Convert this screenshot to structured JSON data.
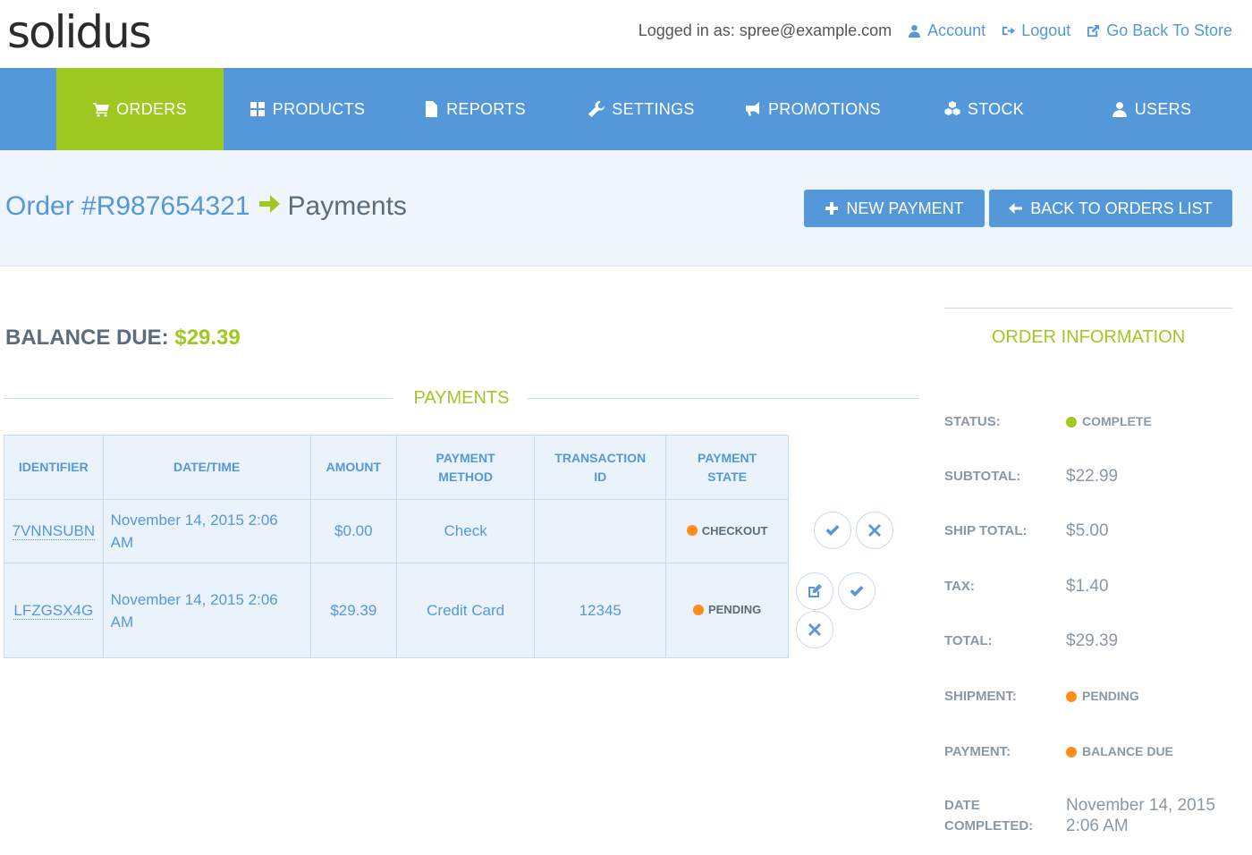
{
  "brand": {
    "logo": "solidus"
  },
  "topbar": {
    "logged_in": "Logged in as: spree@example.com",
    "account": "Account",
    "logout": "Logout",
    "store": "Go Back To Store"
  },
  "nav": {
    "orders": "ORDERS",
    "products": "PRODUCTS",
    "reports": "REPORTS",
    "settings": "SETTINGS",
    "promotions": "PROMOTIONS",
    "stock": "STOCK",
    "users": "USERS",
    "active": "orders"
  },
  "page": {
    "order": "Order #R987654321",
    "section": "Payments",
    "new_payment": "NEW PAYMENT",
    "back": "BACK TO ORDERS LIST"
  },
  "balance": {
    "label": "BALANCE DUE:",
    "amount": "$29.39"
  },
  "payments": {
    "heading": "PAYMENTS",
    "columns": {
      "identifier": "IDENTIFIER",
      "datetime": "DATE/TIME",
      "amount": "AMOUNT",
      "method": "PAYMENT METHOD",
      "txn": "TRANSACTION ID",
      "state": "PAYMENT STATE"
    },
    "rows": [
      {
        "identifier": "7VNNSUBN",
        "datetime": "November 14, 2015 2:06 AM",
        "amount": "$0.00",
        "method": "Check",
        "txn": "",
        "state": "CHECKOUT"
      },
      {
        "identifier": "LFZGSX4G",
        "datetime": "November 14, 2015 2:06 AM",
        "amount": "$29.39",
        "method": "Credit Card",
        "txn": "12345",
        "state": "PENDING"
      }
    ]
  },
  "order_info": {
    "title": "ORDER INFORMATION",
    "status_label": "STATUS:",
    "status": "COMPLETE",
    "subtotal_label": "SUBTOTAL:",
    "subtotal": "$22.99",
    "ship_label": "SHIP TOTAL:",
    "ship": "$5.00",
    "tax_label": "TAX:",
    "tax": "$1.40",
    "total_label": "TOTAL:",
    "total": "$29.39",
    "shipment_label": "SHIPMENT:",
    "shipment": "PENDING",
    "payment_label": "PAYMENT:",
    "payment": "BALANCE DUE",
    "completed_label": "DATE COMPLETED:",
    "completed": "November 14, 2015 2:06 AM"
  },
  "colors": {
    "primary": "#5498da",
    "accent": "#9fc820",
    "pending": "#ff8c1a",
    "complete": "#9fc820"
  }
}
